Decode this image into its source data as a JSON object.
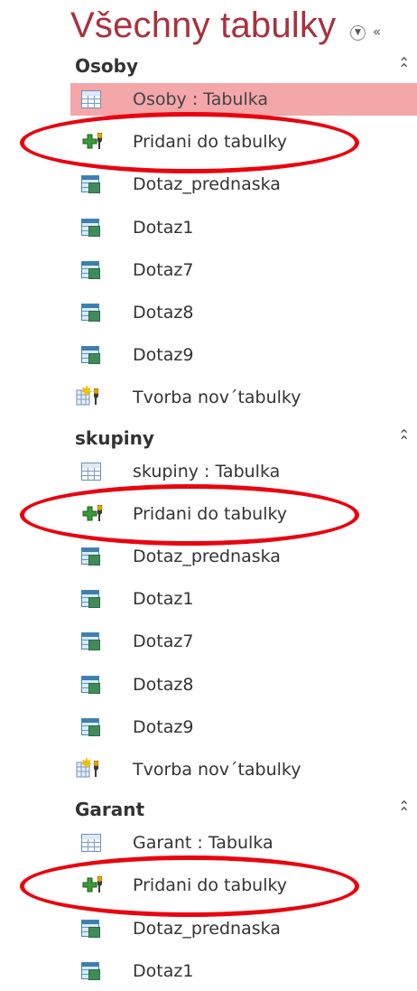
{
  "pane": {
    "title": "Všechny tabulky",
    "menu_icon": "chevron-circle-down-icon",
    "shutter_icon": "double-chevron-left-icon"
  },
  "groups": [
    {
      "name": "Osoby",
      "collapse_icon": "double-chevron-up-icon",
      "items": [
        {
          "label": "Osoby : Tabulka",
          "type": "table",
          "selected": true
        },
        {
          "label": "Pridani do tabulky",
          "type": "append",
          "circled": true
        },
        {
          "label": "Dotaz_prednaska",
          "type": "query"
        },
        {
          "label": "Dotaz1",
          "type": "query"
        },
        {
          "label": "Dotaz7",
          "type": "query"
        },
        {
          "label": "Dotaz8",
          "type": "query"
        },
        {
          "label": "Dotaz9",
          "type": "query"
        },
        {
          "label": "Tvorba nov´tabulky",
          "type": "maketable"
        }
      ]
    },
    {
      "name": "skupiny",
      "collapse_icon": "double-chevron-up-icon",
      "items": [
        {
          "label": "skupiny : Tabulka",
          "type": "table"
        },
        {
          "label": "Pridani do tabulky",
          "type": "append",
          "circled": true
        },
        {
          "label": "Dotaz_prednaska",
          "type": "query"
        },
        {
          "label": "Dotaz1",
          "type": "query"
        },
        {
          "label": "Dotaz7",
          "type": "query"
        },
        {
          "label": "Dotaz8",
          "type": "query"
        },
        {
          "label": "Dotaz9",
          "type": "query"
        },
        {
          "label": "Tvorba nov´tabulky",
          "type": "maketable"
        }
      ]
    },
    {
      "name": "Garant",
      "collapse_icon": "double-chevron-up-icon",
      "items": [
        {
          "label": "Garant : Tabulka",
          "type": "table"
        },
        {
          "label": "Pridani do tabulky",
          "type": "append",
          "circled": true
        },
        {
          "label": "Dotaz_prednaska",
          "type": "query"
        },
        {
          "label": "Dotaz1",
          "type": "query"
        }
      ]
    }
  ],
  "colors": {
    "title": "#a8323e",
    "selected_row": "#f4a7a9",
    "annotation": "#e8050f"
  }
}
